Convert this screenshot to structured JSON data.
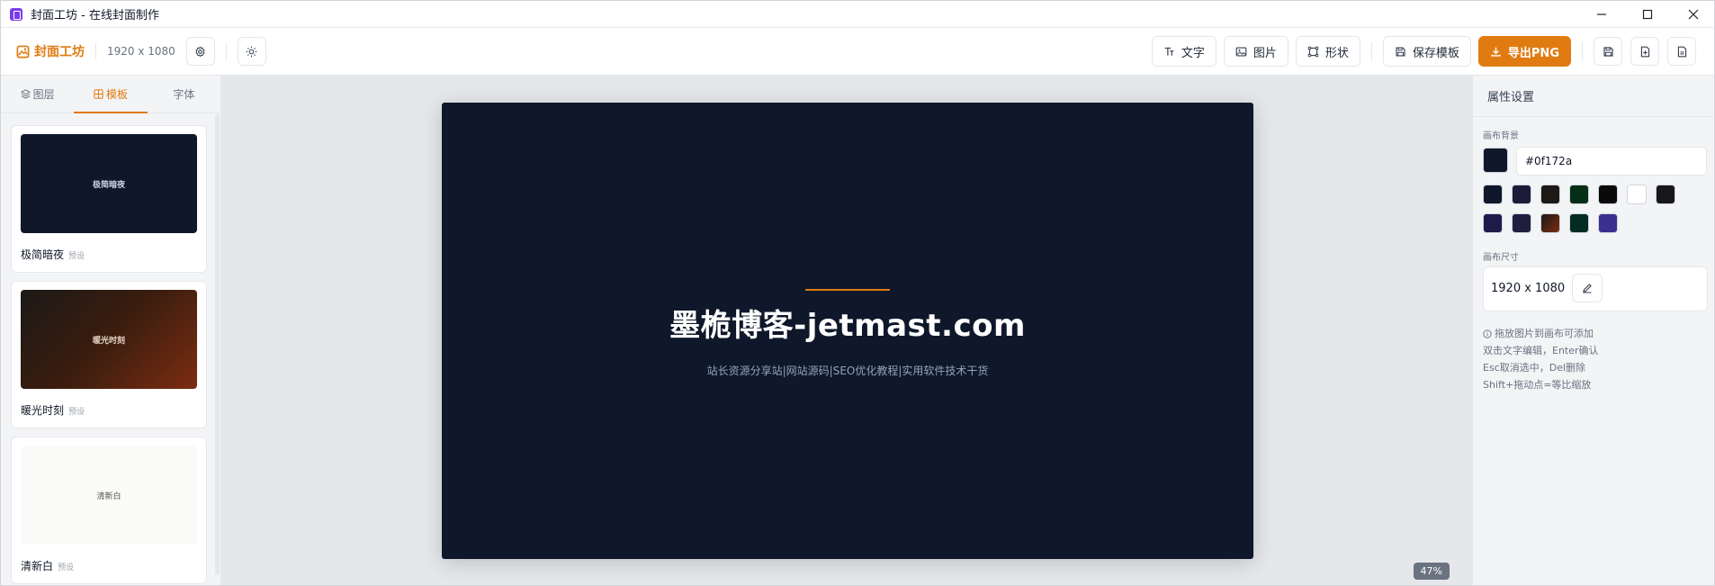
{
  "window": {
    "title": "封面工坊 - 在线封面制作"
  },
  "toolbar": {
    "brand": "封面工坊",
    "canvas_size": "1920 x 1080",
    "text_label": "文字",
    "image_label": "图片",
    "shape_label": "形状",
    "save_template_label": "保存模板",
    "export_label": "导出PNG"
  },
  "left_panel": {
    "tabs": [
      {
        "label": "图层",
        "icon": "layers-icon"
      },
      {
        "label": "模板",
        "icon": "grid-icon",
        "active": true
      },
      {
        "label": "字体"
      }
    ],
    "templates": [
      {
        "name": "极简暗夜",
        "tag": "预设",
        "preview_text": "极简暗夜"
      },
      {
        "name": "暖光时刻",
        "tag": "预设",
        "preview_text": "暖光时刻"
      },
      {
        "name": "清新白",
        "tag": "预设",
        "preview_text": "清新白"
      }
    ]
  },
  "canvas": {
    "title": "墨桅博客-jetmast.com",
    "subtitle": "站长资源分享站|网站源码|SEO优化教程|实用软件技术干货",
    "background": "#0f172a",
    "accent": "#e07b12",
    "zoom": "47%"
  },
  "right_panel": {
    "header": "属性设置",
    "bg_label": "画布背景",
    "bg_value": "#0f172a",
    "presets": [
      "#0f172a",
      "#1e1b3a",
      "#1c1917",
      "#052e16",
      "#0a0a0a",
      "#ffffff",
      "#18181b",
      "#1e1b4b",
      "#1e1e3f",
      "#7c2d12",
      "#022c22",
      "#3b2f8f"
    ],
    "size_label": "画布尺寸",
    "size_value": "1920 x 1080",
    "tips": [
      "拖放图片到画布可添加",
      "双击文字编辑，Enter确认",
      "Esc取消选中，Del删除",
      "Shift+拖动点=等比缩放"
    ]
  }
}
